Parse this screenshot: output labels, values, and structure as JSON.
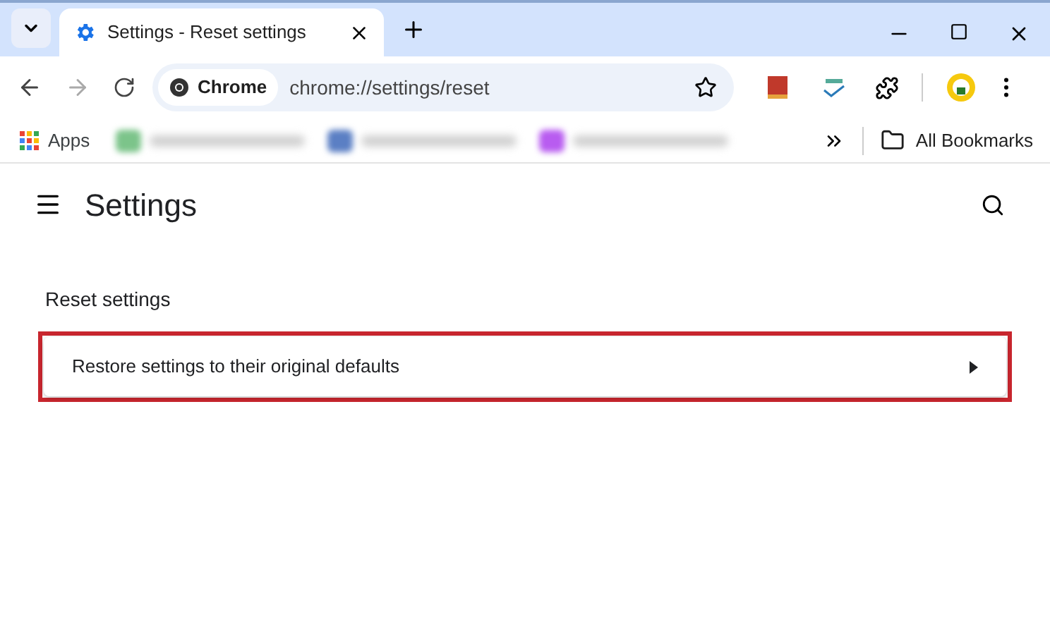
{
  "tab": {
    "title": "Settings - Reset settings"
  },
  "omnibox": {
    "chip": "Chrome",
    "url": "chrome://settings/reset"
  },
  "bookmarks": [
    {
      "label": "Apps",
      "kind": "apps"
    },
    {
      "kind": "blurred",
      "color": "#7cc48a"
    },
    {
      "kind": "blurred",
      "color": "#5b7fc4"
    },
    {
      "kind": "blurred",
      "color": "#b85cf0"
    }
  ],
  "all_bookmarks": "All Bookmarks",
  "page": {
    "title": "Settings",
    "section": "Reset settings",
    "rows": [
      {
        "label": "Restore settings to their original defaults",
        "highlighted": true
      }
    ]
  }
}
